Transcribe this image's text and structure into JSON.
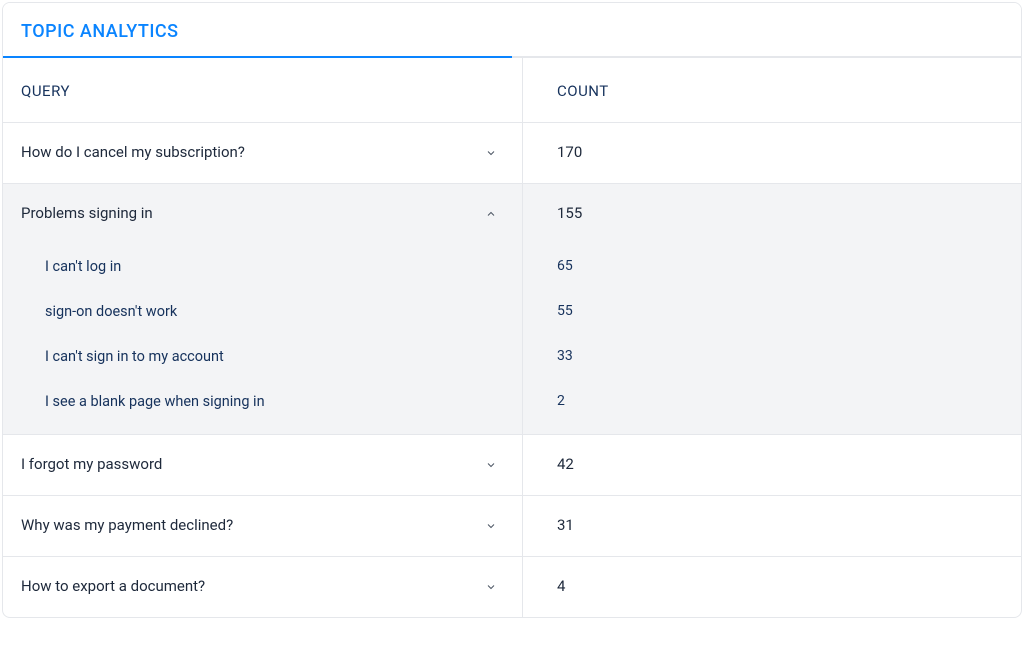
{
  "panel": {
    "title": "TOPIC ANALYTICS",
    "columns": {
      "query": "QUERY",
      "count": "COUNT"
    },
    "rows": [
      {
        "query": "How do I cancel my subscription?",
        "count": "170",
        "expanded": false
      },
      {
        "query": "Problems signing in",
        "count": "155",
        "expanded": true,
        "children": [
          {
            "query": "I can't log in",
            "count": "65"
          },
          {
            "query": "sign-on doesn't work",
            "count": "55"
          },
          {
            "query": "I can't sign in to my account",
            "count": "33"
          },
          {
            "query": "I see a blank page when signing in",
            "count": "2"
          }
        ]
      },
      {
        "query": "I forgot my password",
        "count": "42",
        "expanded": false
      },
      {
        "query": "Why was my payment declined?",
        "count": "31",
        "expanded": false
      },
      {
        "query": "How to export a document?",
        "count": "4",
        "expanded": false
      }
    ]
  }
}
